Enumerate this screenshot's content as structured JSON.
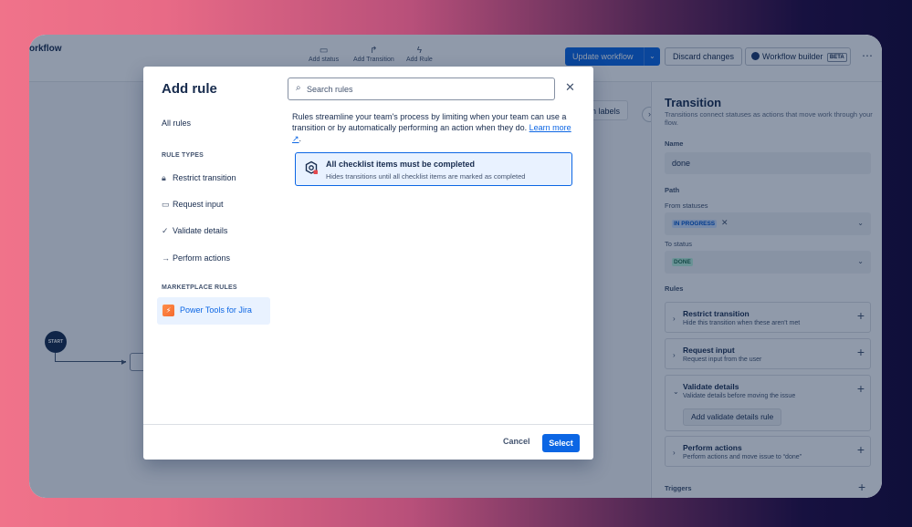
{
  "header": {
    "workflow_title": "orkflow",
    "tools": [
      {
        "label": "Add status",
        "icon": "status-icon"
      },
      {
        "label": "Add Transition",
        "icon": "transition-icon"
      },
      {
        "label": "Add Rule",
        "icon": "lightning-icon"
      }
    ],
    "update_label": "Update workflow",
    "discard_label": "Discard changes",
    "builder_label": "Workflow builder",
    "builder_badge": "BETA",
    "more_icon": "more-icon"
  },
  "canvas": {
    "start_label": "START",
    "transition_labels_button": "ion labels"
  },
  "panel": {
    "title": "Transition",
    "subtitle": "Transitions connect statuses as actions that move work through your flow.",
    "name_label": "Name",
    "name_value": "done",
    "path_label": "Path",
    "from_label": "From statuses",
    "from_value": "IN PROGRESS",
    "to_label": "To status",
    "to_value": "DONE",
    "rules_label": "Rules",
    "rules": [
      {
        "title": "Restrict transition",
        "subtitle": "Hide this transition when these aren't met"
      },
      {
        "title": "Request input",
        "subtitle": "Request input from the user"
      },
      {
        "title": "Validate details",
        "subtitle": "Validate details before moving the issue",
        "action": "Add validate details rule"
      },
      {
        "title": "Perform actions",
        "subtitle": "Perform actions and move issue to “done”"
      }
    ],
    "triggers_label": "Triggers"
  },
  "modal": {
    "title": "Add rule",
    "all_rules": "All rules",
    "rule_types_heading": "RULE TYPES",
    "rule_types": [
      {
        "label": "Restrict transition",
        "icon": "lock-icon"
      },
      {
        "label": "Request input",
        "icon": "input-icon"
      },
      {
        "label": "Validate details",
        "icon": "check-icon"
      },
      {
        "label": "Perform actions",
        "icon": "arrow-right-icon"
      }
    ],
    "marketplace_heading": "MARKETPLACE RULES",
    "marketplace_item": "Power Tools for Jira",
    "search_placeholder": "Search rules",
    "description": "Rules streamline your team's process by limiting when your team can use a transition or by automatically performing an action when they do.",
    "learn_more": "Learn more",
    "card_title": "All checklist items must be completed",
    "card_subtitle": "Hides transitions until all checklist items are marked as completed",
    "cancel_label": "Cancel",
    "select_label": "Select"
  }
}
